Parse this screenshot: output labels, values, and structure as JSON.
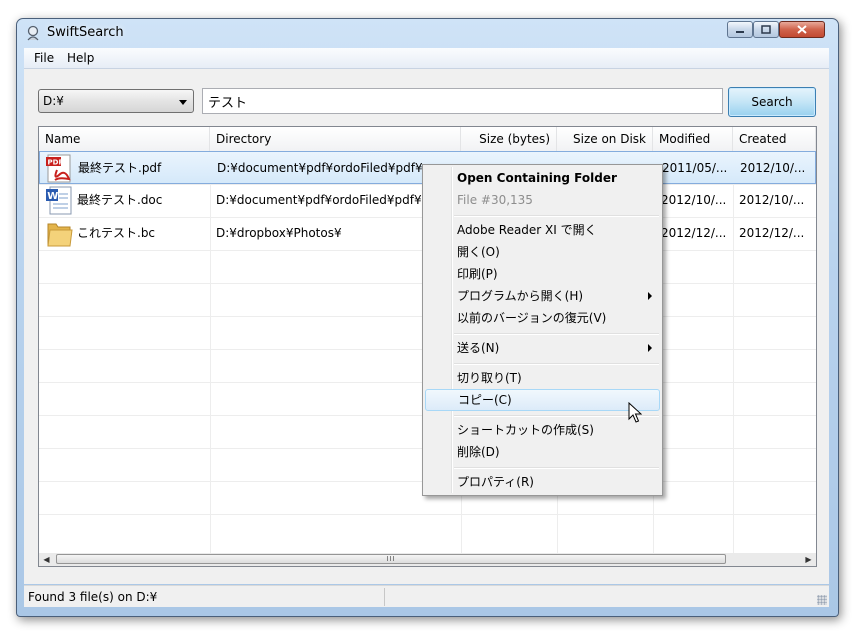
{
  "window": {
    "title": "SwiftSearch"
  },
  "menubar": {
    "items": [
      "File",
      "Help"
    ]
  },
  "toolbar": {
    "drive_value": "D:¥",
    "search_value": "テスト",
    "search_button_label": "Search"
  },
  "table": {
    "columns": [
      "Name",
      "Directory",
      "Size (bytes)",
      "Size on Disk",
      "Modified",
      "Created"
    ],
    "rows": [
      {
        "icon": "pdf-file-icon",
        "name": "最終テスト.pdf",
        "directory": "D:¥document¥pdf¥ordoFiled¥pdf¥",
        "size": "",
        "size_on_disk": "",
        "modified": "2011/05/...",
        "created": "2012/10/..."
      },
      {
        "icon": "word-file-icon",
        "name": "最終テスト.doc",
        "directory": "D:¥document¥pdf¥ordoFiled¥pdf¥",
        "size": "",
        "size_on_disk": "",
        "modified": "2012/10/...",
        "created": "2012/10/..."
      },
      {
        "icon": "folder-icon",
        "name": "これテスト.bc",
        "directory": "D:¥dropbox¥Photos¥",
        "size": "",
        "size_on_disk": "",
        "modified": "2012/12/...",
        "created": "2012/12/..."
      }
    ],
    "scrollbar_thumb": "III"
  },
  "context_menu": {
    "items": [
      {
        "label": "Open Containing Folder",
        "style": "bold"
      },
      {
        "label": "File #30,135",
        "style": "disabled"
      },
      {
        "label": "Adobe Reader XI で開く"
      },
      {
        "label": "開く(O)"
      },
      {
        "label": "印刷(P)"
      },
      {
        "label": "プログラムから開く(H)",
        "submenu": true
      },
      {
        "label": "以前のバージョンの復元(V)"
      },
      {
        "label": "送る(N)",
        "submenu": true
      },
      {
        "label": "切り取り(T)"
      },
      {
        "label": "コピー(C)",
        "style": "hover"
      },
      {
        "label": "ショートカットの作成(S)"
      },
      {
        "label": "削除(D)"
      },
      {
        "label": "プロパティ(R)"
      }
    ]
  },
  "statusbar": {
    "text": "Found 3 file(s) on D:¥"
  },
  "colors": {
    "selection": "#d5e9fa",
    "accent": "#3c7fb1"
  }
}
